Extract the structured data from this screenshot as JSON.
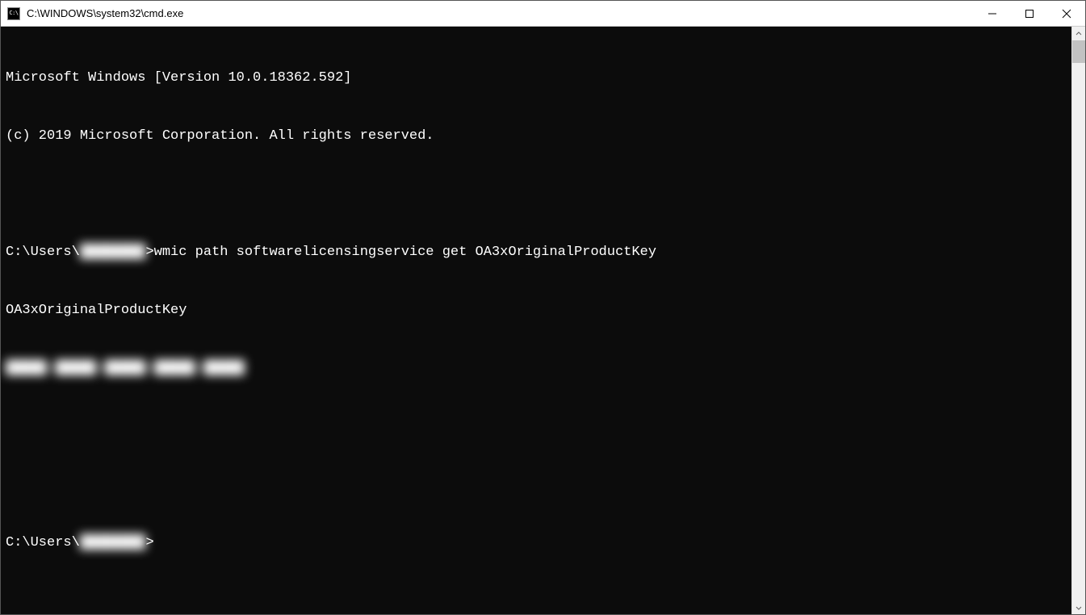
{
  "titlebar": {
    "icon_label": "C:\\",
    "title": "C:\\WINDOWS\\system32\\cmd.exe"
  },
  "terminal": {
    "banner_line1": "Microsoft Windows [Version 10.0.18362.592]",
    "banner_line2": "(c) 2019 Microsoft Corporation. All rights reserved.",
    "prompt_prefix": "C:\\Users\\",
    "prompt_blurred_user": "████████",
    "prompt_suffix": ">",
    "command": "wmic path softwarelicensingservice get OA3xOriginalProductKey",
    "output_header": "OA3xOriginalProductKey",
    "output_key_blurred": "█████-█████-█████-█████-█████",
    "cursor": "_"
  }
}
